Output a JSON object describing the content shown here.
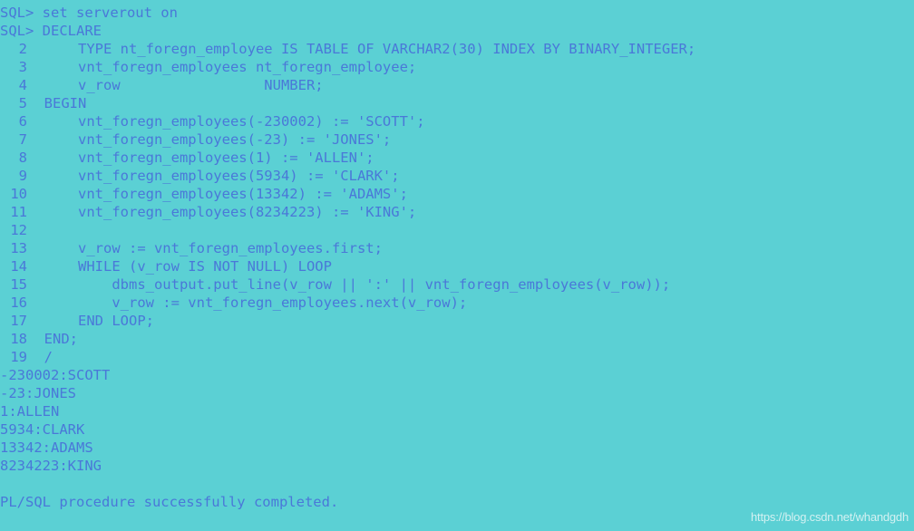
{
  "terminal": {
    "background_color": "#5bd0d4",
    "text_color": "#4a78d8",
    "watermark_color": "#f5fafa",
    "watermark": "https://blog.csdn.net/whandgdh",
    "lines": [
      {
        "type": "prompt",
        "gutter": "SQL>",
        "text": " set serverout on"
      },
      {
        "type": "prompt",
        "gutter": "SQL>",
        "text": " DECLARE"
      },
      {
        "type": "code",
        "gutter": "2",
        "text": "      TYPE nt_foregn_employee IS TABLE OF VARCHAR2(30) INDEX BY BINARY_INTEGER;"
      },
      {
        "type": "code",
        "gutter": "3",
        "text": "      vnt_foregn_employees nt_foregn_employee;"
      },
      {
        "type": "code",
        "gutter": "4",
        "text": "      v_row                 NUMBER;"
      },
      {
        "type": "code",
        "gutter": "5",
        "text": "  BEGIN"
      },
      {
        "type": "code",
        "gutter": "6",
        "text": "      vnt_foregn_employees(-230002) := 'SCOTT';"
      },
      {
        "type": "code",
        "gutter": "7",
        "text": "      vnt_foregn_employees(-23) := 'JONES';"
      },
      {
        "type": "code",
        "gutter": "8",
        "text": "      vnt_foregn_employees(1) := 'ALLEN';"
      },
      {
        "type": "code",
        "gutter": "9",
        "text": "      vnt_foregn_employees(5934) := 'CLARK';"
      },
      {
        "type": "code",
        "gutter": "10",
        "text": "      vnt_foregn_employees(13342) := 'ADAMS';"
      },
      {
        "type": "code",
        "gutter": "11",
        "text": "      vnt_foregn_employees(8234223) := 'KING';"
      },
      {
        "type": "code",
        "gutter": "12",
        "text": ""
      },
      {
        "type": "code",
        "gutter": "13",
        "text": "      v_row := vnt_foregn_employees.first;"
      },
      {
        "type": "code",
        "gutter": "14",
        "text": "      WHILE (v_row IS NOT NULL) LOOP"
      },
      {
        "type": "code",
        "gutter": "15",
        "text": "          dbms_output.put_line(v_row || ':' || vnt_foregn_employees(v_row));"
      },
      {
        "type": "code",
        "gutter": "16",
        "text": "          v_row := vnt_foregn_employees.next(v_row);"
      },
      {
        "type": "code",
        "gutter": "17",
        "text": "      END LOOP;"
      },
      {
        "type": "code",
        "gutter": "18",
        "text": "  END;"
      },
      {
        "type": "code",
        "gutter": "19",
        "text": "  /"
      },
      {
        "type": "output",
        "gutter": "",
        "text": "-230002:SCOTT"
      },
      {
        "type": "output",
        "gutter": "",
        "text": "-23:JONES"
      },
      {
        "type": "output",
        "gutter": "",
        "text": "1:ALLEN"
      },
      {
        "type": "output",
        "gutter": "",
        "text": "5934:CLARK"
      },
      {
        "type": "output",
        "gutter": "",
        "text": "13342:ADAMS"
      },
      {
        "type": "output",
        "gutter": "",
        "text": "8234223:KING"
      },
      {
        "type": "blank",
        "gutter": "",
        "text": ""
      },
      {
        "type": "output",
        "gutter": "",
        "text": "PL/SQL procedure successfully completed."
      }
    ]
  }
}
